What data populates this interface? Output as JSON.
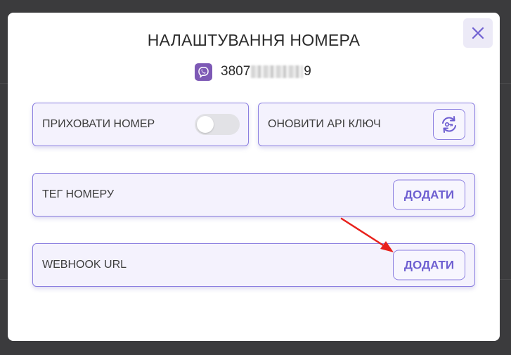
{
  "modal": {
    "title": "НАЛАШТУВАННЯ НОМЕРА",
    "phone_visible_start": "3807",
    "phone_visible_end": "9"
  },
  "cards": {
    "hide_number_label": "ПРИХОВАТИ НОМЕР",
    "hide_number_toggle_on": false,
    "update_api_label": "ОНОВИТИ API КЛЮЧ",
    "tag_label": "ТЕГ НОМЕРУ",
    "tag_add_label": "ДОДАТИ",
    "webhook_label": "WEBHOOK URL",
    "webhook_add_label": "ДОДАТИ"
  },
  "colors": {
    "accent": "#6e5fd1",
    "card_border": "#8b7fe0",
    "card_bg": "#f4f2fd",
    "viber": "#7d59b5",
    "annotation_arrow": "#e8211c"
  },
  "icons": [
    "close-icon",
    "viber-icon",
    "refresh-key-icon"
  ]
}
